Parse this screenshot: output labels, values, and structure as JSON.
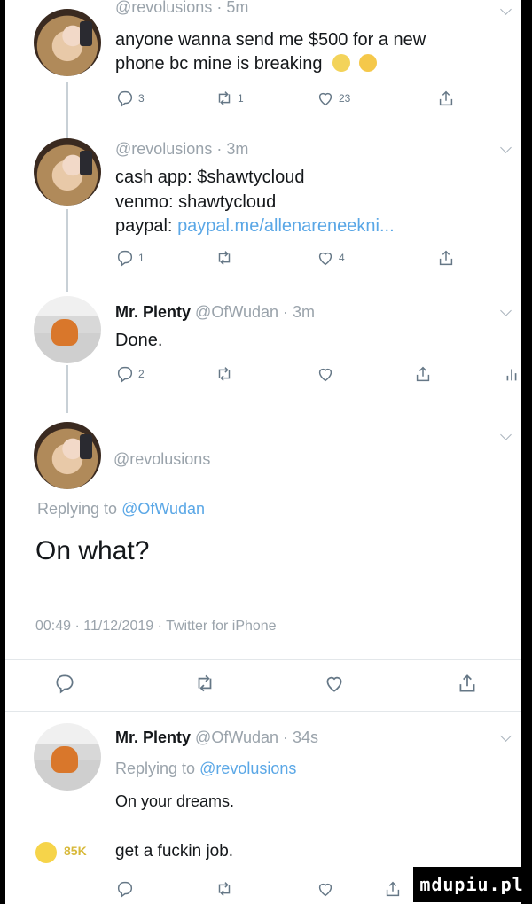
{
  "tweets": [
    {
      "handle": "@revolusions · 5m",
      "text_line1": "anyone wanna send me $500 for a new",
      "text_line2": "phone bc mine is breaking",
      "reply_count": "3",
      "retweet_count": "1",
      "like_count": "23"
    },
    {
      "handle": "@revolusions · 3m",
      "line1": "cash app: $shawtycloud",
      "line2": "venmo: shawtycloud",
      "line3_label": "paypal:",
      "line3_link": "paypal.me/allenareneekni...",
      "reply_count": "1",
      "retweet_count": "",
      "like_count": "4"
    },
    {
      "name": "Mr. Plenty",
      "handle": "@OfWudan · 3m",
      "text": "Done.",
      "reply_count": "2"
    }
  ],
  "focus": {
    "handle": "@revolusions",
    "replying_prefix": "Replying to",
    "replying_to": "@OfWudan",
    "text": "On what?",
    "meta_time": "00:49 · 11/12/2019 · ",
    "meta_client": "Twitter for iPhone"
  },
  "reply": {
    "name": "Mr. Plenty",
    "handle": "@OfWudan · 34s",
    "replying_prefix": "Replying to",
    "replying_to": "@revolusions",
    "text": "On your dreams."
  },
  "comment": {
    "likes": "85K",
    "text": "get a fuckin job."
  },
  "watermark": "mdupiu.pl",
  "colors": {
    "link": "#5aa7e6",
    "icon": "#657786",
    "watermark_bg": "#000000"
  }
}
